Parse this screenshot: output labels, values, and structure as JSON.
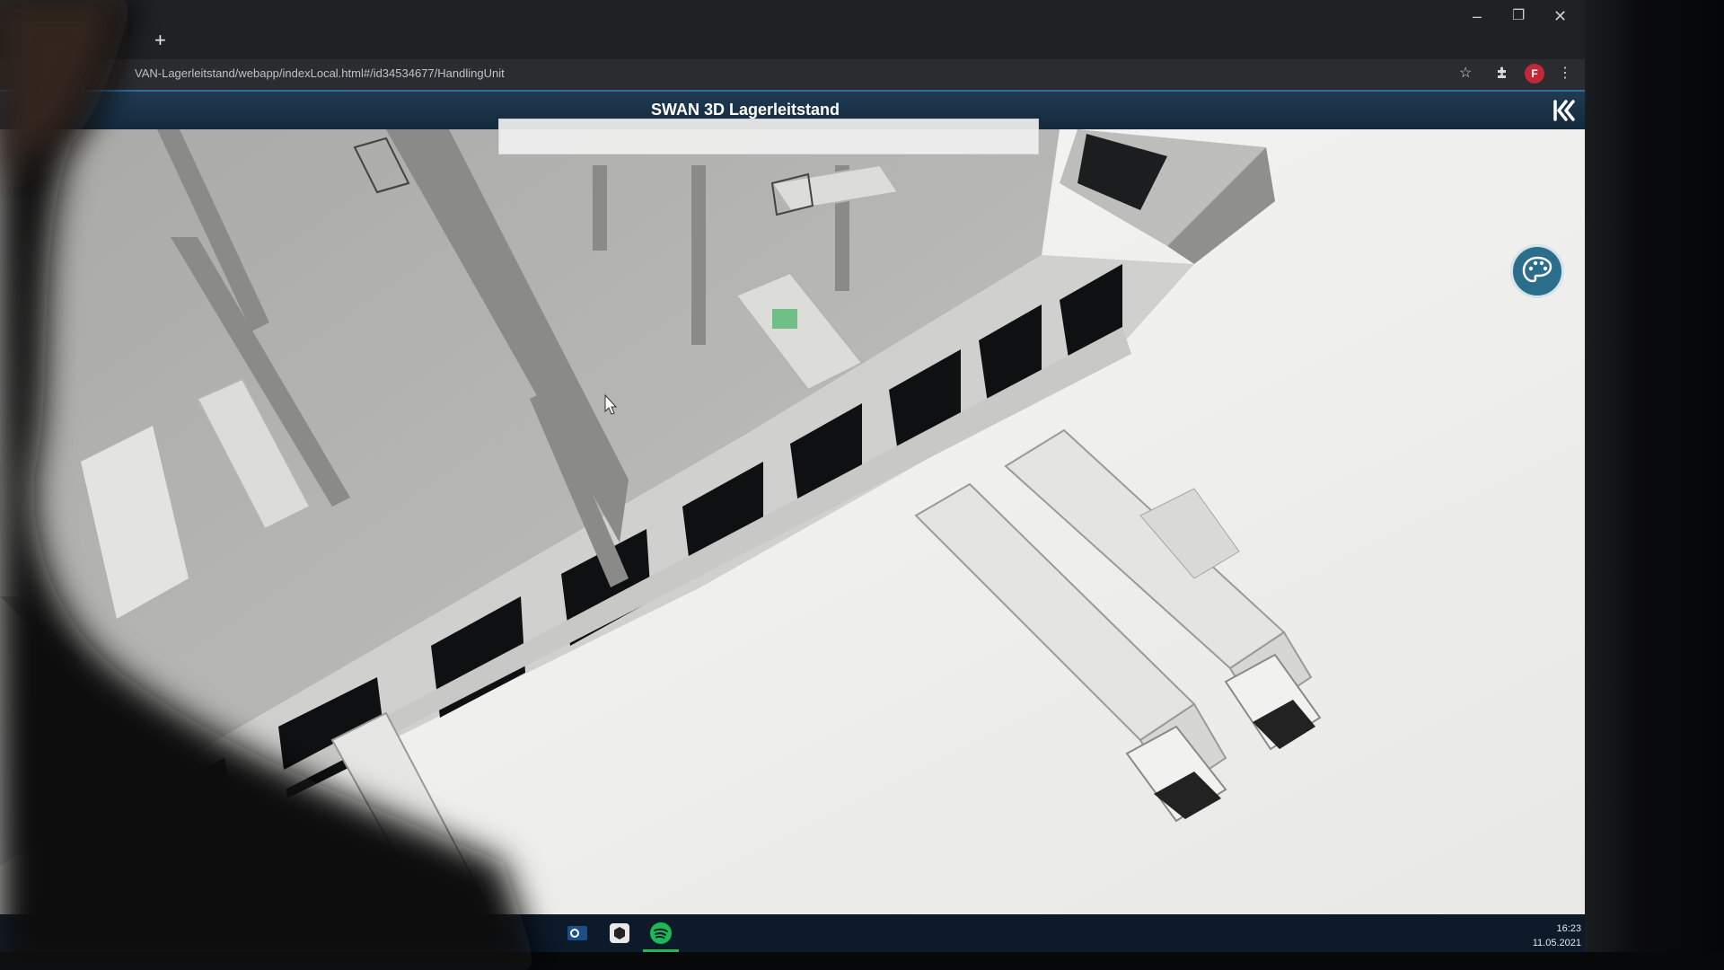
{
  "browser": {
    "new_tab_label": "+",
    "window_controls": {
      "minimize": "–",
      "restore": "❐",
      "close": "✕"
    },
    "url": "VAN-Lagerleitstand/webapp/indexLocal.html#/id34534677/HandlingUnit",
    "toolbar_icons": [
      "star-icon",
      "puzzle-icon",
      "menu-icon"
    ],
    "profile_initial": "F"
  },
  "app": {
    "title": "SWAN 3D Lagerleitstand",
    "header_color": "#1f3a52",
    "accent_color": "#2a6e8c",
    "icons": [
      "collapse-icon",
      "palette-icon"
    ]
  },
  "taskbar": {
    "icons": [
      "outlook-icon",
      "app-icon",
      "spotify-icon"
    ],
    "time": "16:23",
    "date": "11.05.2021"
  }
}
